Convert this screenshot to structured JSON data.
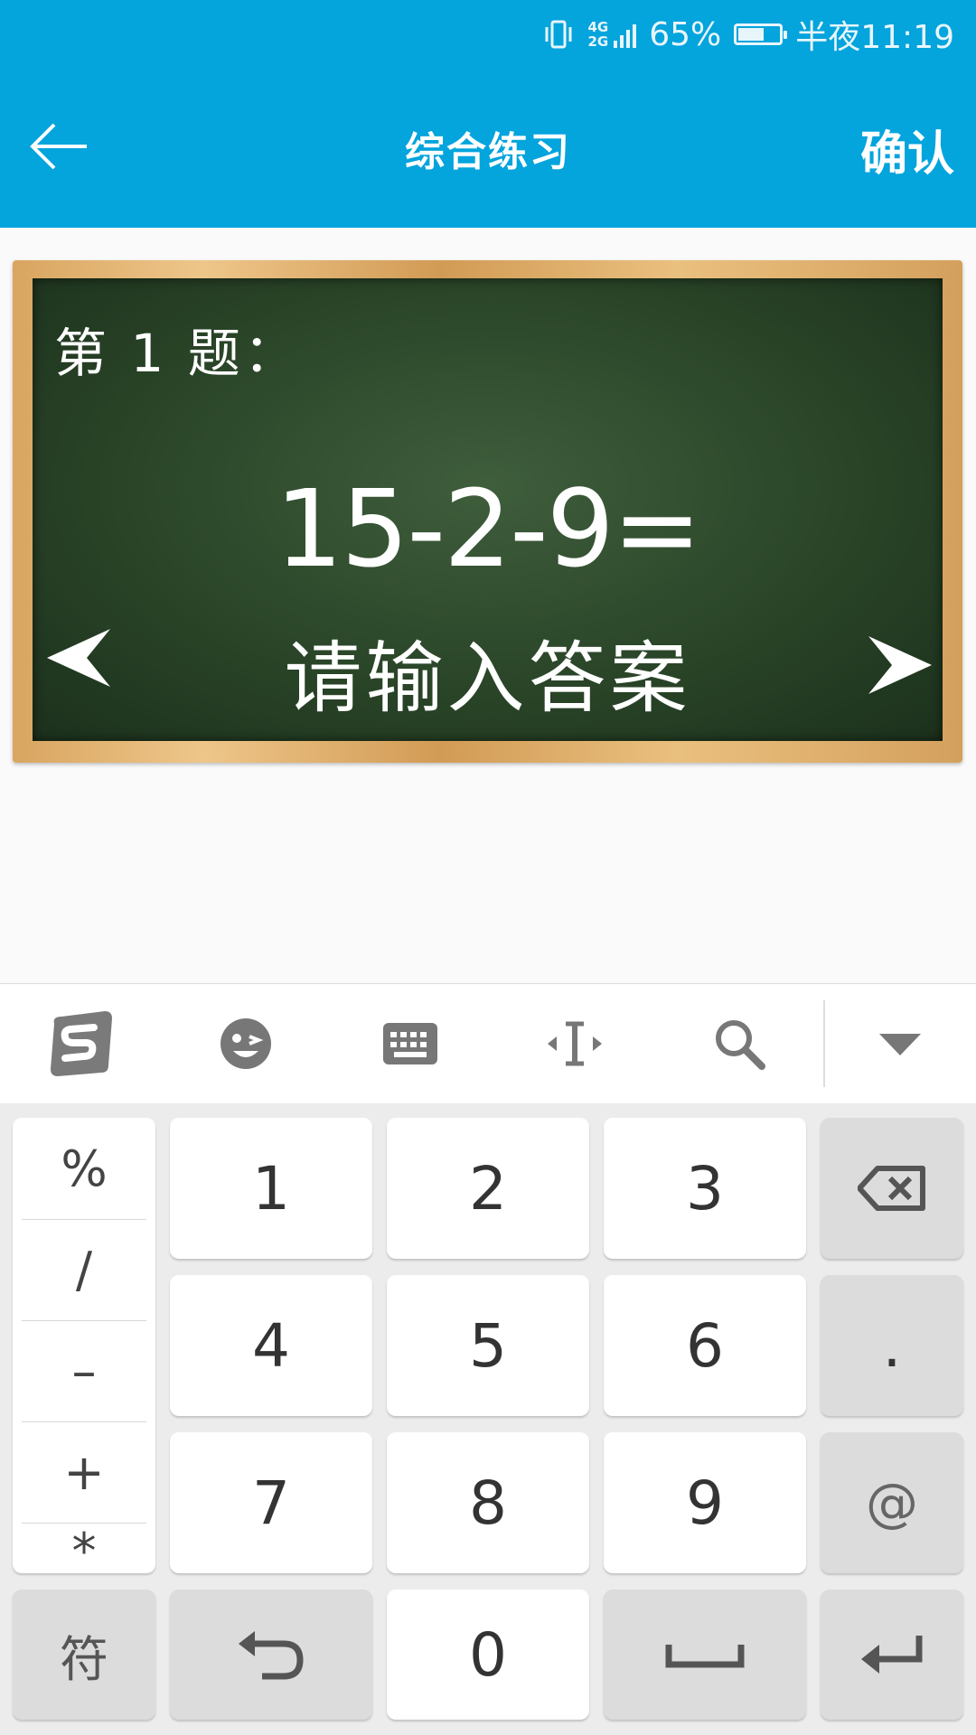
{
  "status_bar": {
    "network": "4G",
    "network2": "2G",
    "battery_percent": "65%",
    "battery_level": 0.65,
    "time": "半夜11:19"
  },
  "app_bar": {
    "title": "综合练习",
    "confirm_label": "确认"
  },
  "board": {
    "question_label": "第 1 题：",
    "expression": "15-2-9=",
    "answer_placeholder": "请输入答案"
  },
  "keyboard": {
    "toolbar_icons": [
      "sogou-logo-icon",
      "emoji-icon",
      "keyboard-icon",
      "cursor-move-icon",
      "search-icon",
      "collapse-icon"
    ],
    "symbols": [
      "%",
      "/",
      "–",
      "+",
      "*"
    ],
    "digits": [
      "1",
      "2",
      "3",
      "4",
      "5",
      "6",
      "7",
      "8",
      "9",
      "0"
    ],
    "dot": ".",
    "at": "@",
    "symbol_key": "符"
  },
  "colors": {
    "accent": "#04a4dd",
    "board_green": "#2f4b2d",
    "frame_wood": "#e2b070"
  }
}
